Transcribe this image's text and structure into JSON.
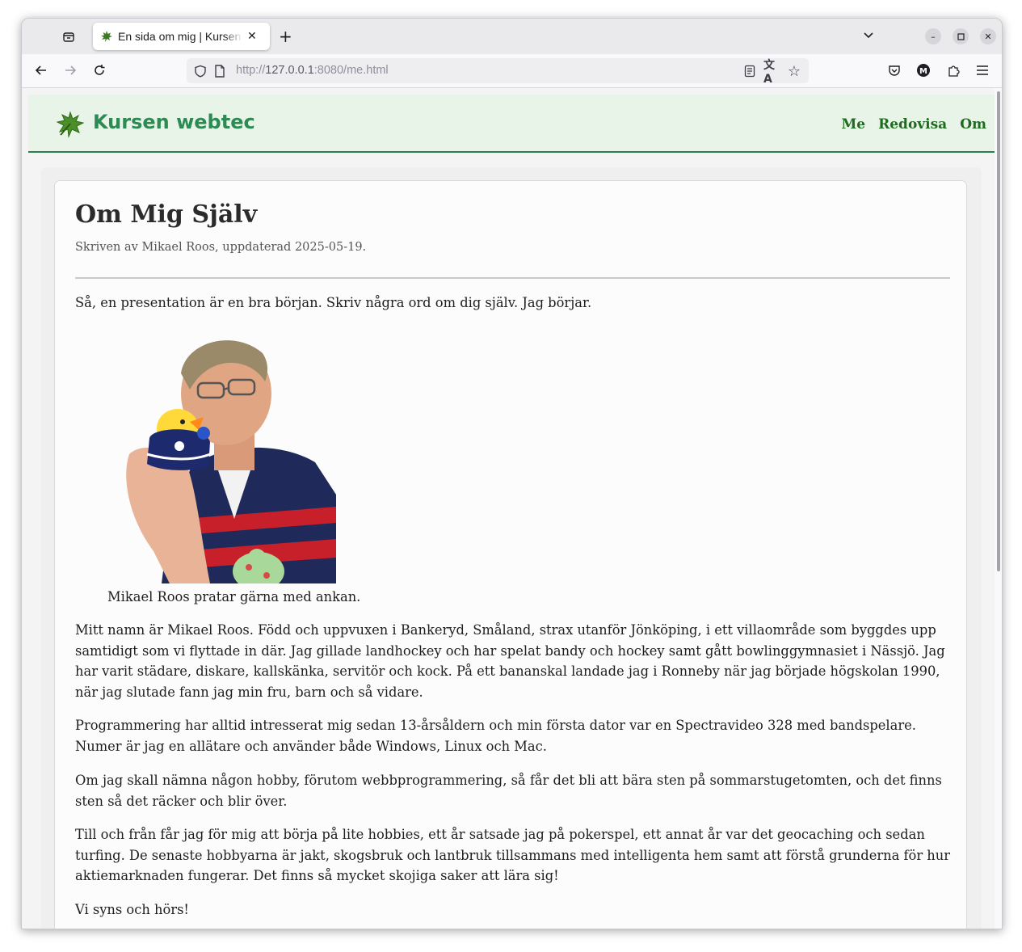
{
  "browser": {
    "tab_title": "En sida om mig | Kursen webtec",
    "url_scheme": "http://",
    "url_host": "127.0.0.1",
    "url_rest": ":8080/me.html"
  },
  "site": {
    "title": "Kursen webtec",
    "nav": [
      "Me",
      "Redovisa",
      "Om"
    ]
  },
  "article": {
    "heading": "Om Mig Själv",
    "byline": "Skriven av Mikael Roos, uppdaterad 2025-05-19.",
    "intro": "Så, en presentation är en bra början. Skriv några ord om dig själv. Jag börjar.",
    "image_caption": "Mikael Roos pratar gärna med ankan.",
    "paragraphs": [
      "Mitt namn är Mikael Roos. Född och uppvuxen i Bankeryd, Småland, strax utanför Jönköping, i ett villaområde som byggdes upp samtidigt som vi flyttade in där. Jag gillade landhockey och har spelat bandy och hockey samt gått bowlinggymnasiet i Nässjö. Jag har varit städare, diskare, kallskänka, servitör och kock. På ett bananskal landade jag i Ronneby när jag började högskolan 1990, när jag slutade fann jag min fru, barn och så vidare.",
      "Programmering har alltid intresserat mig sedan 13-årsåldern och min första dator var en Spectravideo 328 med bandspelare. Numer är jag en allätare och använder både Windows, Linux och Mac.",
      "Om jag skall nämna någon hobby, förutom webbprogrammering, så får det bli att bära sten på sommarstugetomten, och det finns sten så det räcker och blir över.",
      "Till och från får jag för mig att börja på lite hobbies, ett år satsade jag på pokerspel, ett annat år var det geocaching och sedan turfing. De senaste hobbyarna är jakt, skogsbruk och lantbruk tillsammans med intelligenta hem samt att förstå grunderna för hur aktiemarknaden fungerar. Det finns så mycket skojiga saker att lära sig!",
      "Vi syns och hörs!"
    ]
  },
  "colors": {
    "header_bg": "#e9f4e9",
    "header_border": "#2e7d4f",
    "title_green": "#2e8a54",
    "nav_green": "#1f6b1f"
  }
}
